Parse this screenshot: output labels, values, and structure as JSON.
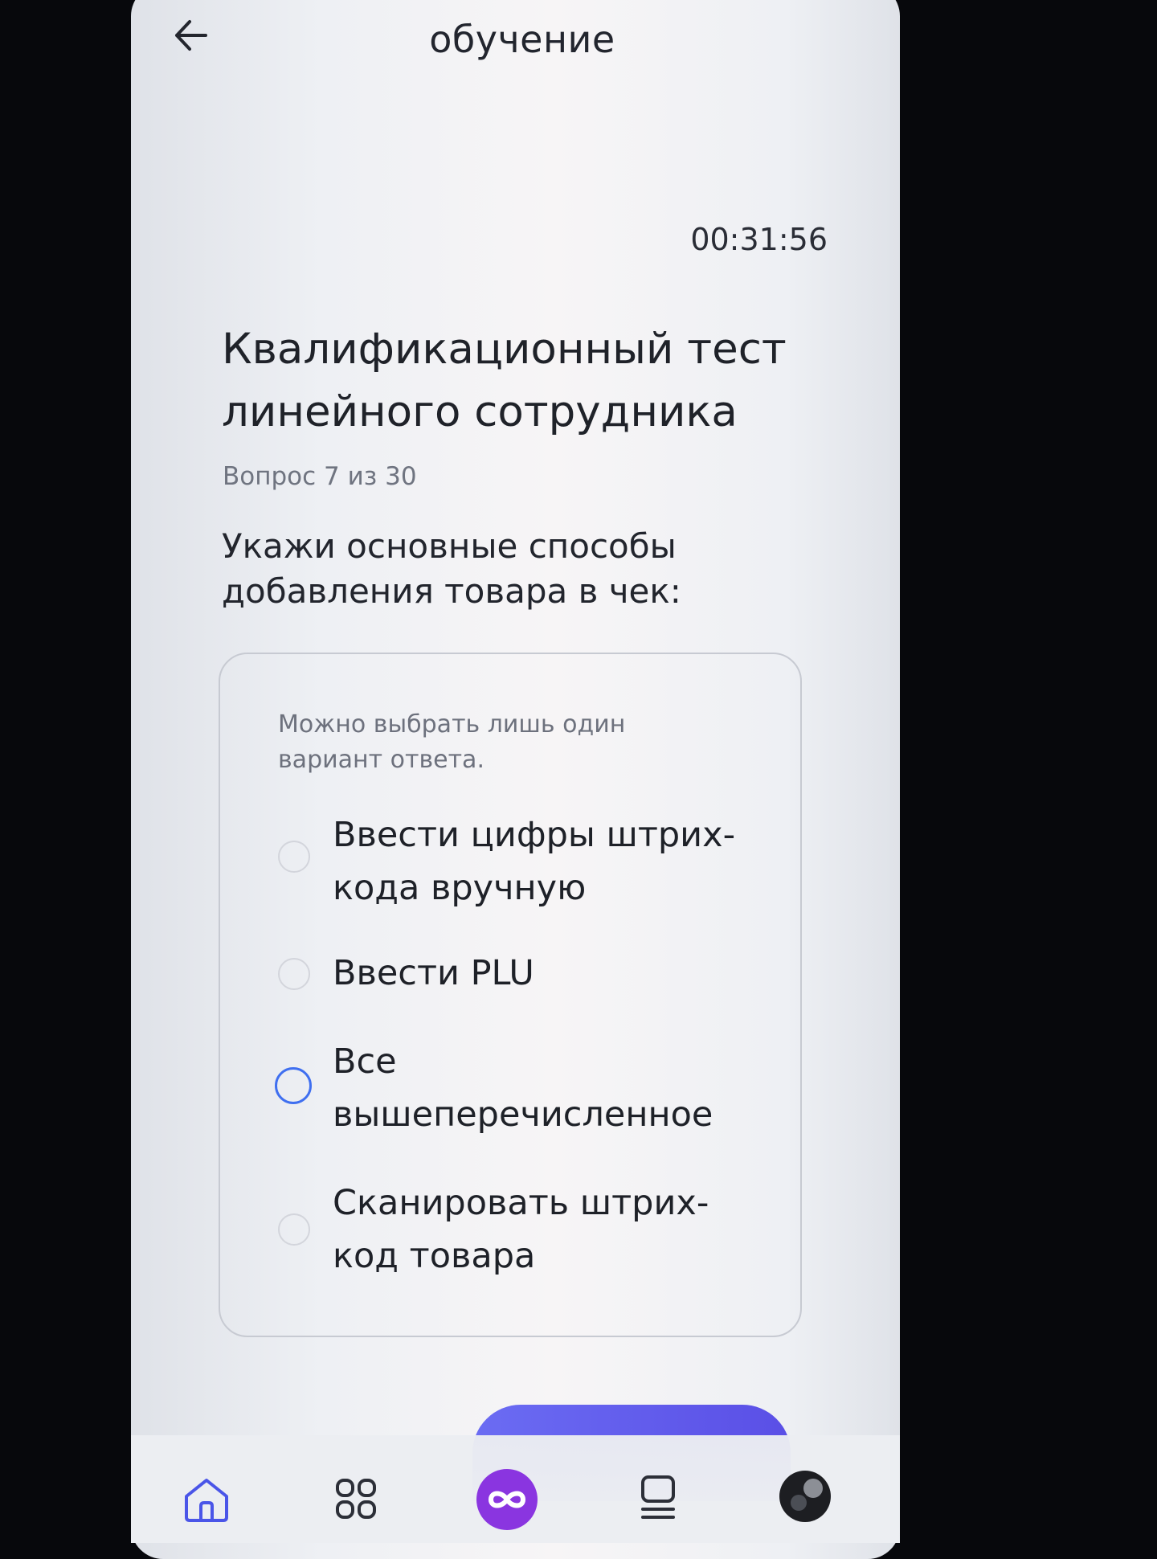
{
  "header": {
    "title": "обучение",
    "back_icon": "arrow-left-icon"
  },
  "timer": "00:31:56",
  "test": {
    "title": "Квалификационный тест линейного сотрудника",
    "counter": "Вопрос 7 из 30",
    "question": "Укажи основные способы добавления товара в чек:"
  },
  "answers": {
    "hint": "Можно выбрать лишь один вариант ответа.",
    "options": [
      {
        "label": "Ввести цифры штрих-кода вручную",
        "selected": false
      },
      {
        "label": "Ввести PLU",
        "selected": false
      },
      {
        "label": "Все вышеперечисленное",
        "selected": false,
        "focused": true
      },
      {
        "label": "Сканировать штрих-код товара",
        "selected": false
      }
    ]
  },
  "colors": {
    "accent": "#5a4fe6",
    "radio_focus": "#3f6ff0",
    "nav_center": "#8a35e0"
  },
  "bottom_nav": [
    {
      "icon": "home-icon"
    },
    {
      "icon": "grid-icon"
    },
    {
      "icon": "infinity-icon"
    },
    {
      "icon": "list-icon"
    },
    {
      "icon": "avatar-icon"
    }
  ]
}
